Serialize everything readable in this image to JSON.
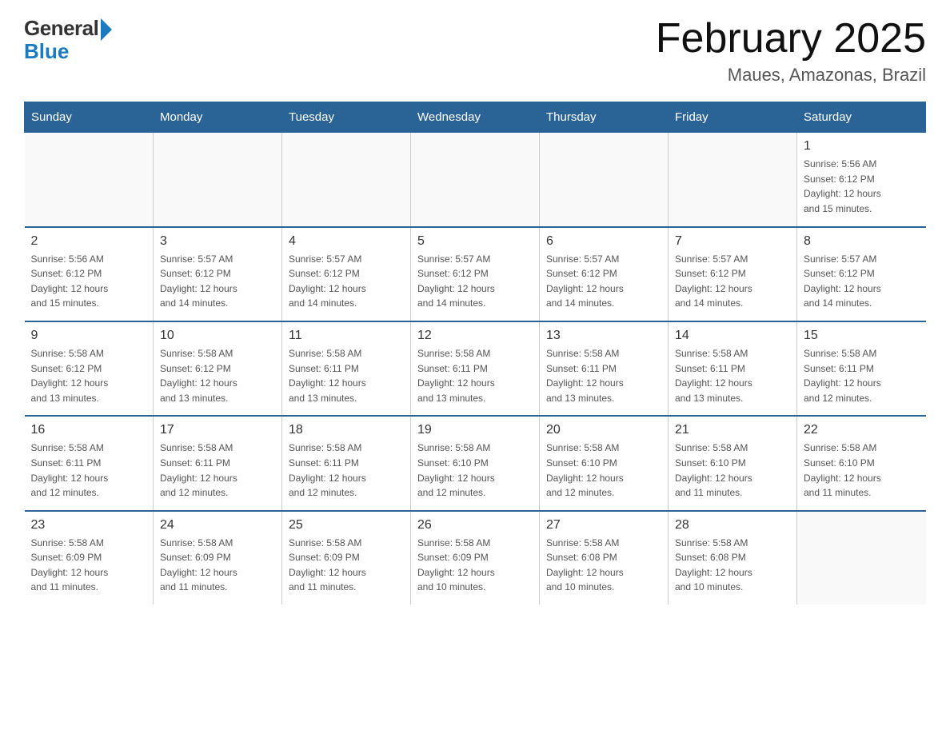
{
  "logo": {
    "general": "General",
    "blue": "Blue"
  },
  "title": "February 2025",
  "location": "Maues, Amazonas, Brazil",
  "days_of_week": [
    "Sunday",
    "Monday",
    "Tuesday",
    "Wednesday",
    "Thursday",
    "Friday",
    "Saturday"
  ],
  "weeks": [
    [
      {
        "day": "",
        "info": ""
      },
      {
        "day": "",
        "info": ""
      },
      {
        "day": "",
        "info": ""
      },
      {
        "day": "",
        "info": ""
      },
      {
        "day": "",
        "info": ""
      },
      {
        "day": "",
        "info": ""
      },
      {
        "day": "1",
        "info": "Sunrise: 5:56 AM\nSunset: 6:12 PM\nDaylight: 12 hours\nand 15 minutes."
      }
    ],
    [
      {
        "day": "2",
        "info": "Sunrise: 5:56 AM\nSunset: 6:12 PM\nDaylight: 12 hours\nand 15 minutes."
      },
      {
        "day": "3",
        "info": "Sunrise: 5:57 AM\nSunset: 6:12 PM\nDaylight: 12 hours\nand 14 minutes."
      },
      {
        "day": "4",
        "info": "Sunrise: 5:57 AM\nSunset: 6:12 PM\nDaylight: 12 hours\nand 14 minutes."
      },
      {
        "day": "5",
        "info": "Sunrise: 5:57 AM\nSunset: 6:12 PM\nDaylight: 12 hours\nand 14 minutes."
      },
      {
        "day": "6",
        "info": "Sunrise: 5:57 AM\nSunset: 6:12 PM\nDaylight: 12 hours\nand 14 minutes."
      },
      {
        "day": "7",
        "info": "Sunrise: 5:57 AM\nSunset: 6:12 PM\nDaylight: 12 hours\nand 14 minutes."
      },
      {
        "day": "8",
        "info": "Sunrise: 5:57 AM\nSunset: 6:12 PM\nDaylight: 12 hours\nand 14 minutes."
      }
    ],
    [
      {
        "day": "9",
        "info": "Sunrise: 5:58 AM\nSunset: 6:12 PM\nDaylight: 12 hours\nand 13 minutes."
      },
      {
        "day": "10",
        "info": "Sunrise: 5:58 AM\nSunset: 6:12 PM\nDaylight: 12 hours\nand 13 minutes."
      },
      {
        "day": "11",
        "info": "Sunrise: 5:58 AM\nSunset: 6:11 PM\nDaylight: 12 hours\nand 13 minutes."
      },
      {
        "day": "12",
        "info": "Sunrise: 5:58 AM\nSunset: 6:11 PM\nDaylight: 12 hours\nand 13 minutes."
      },
      {
        "day": "13",
        "info": "Sunrise: 5:58 AM\nSunset: 6:11 PM\nDaylight: 12 hours\nand 13 minutes."
      },
      {
        "day": "14",
        "info": "Sunrise: 5:58 AM\nSunset: 6:11 PM\nDaylight: 12 hours\nand 13 minutes."
      },
      {
        "day": "15",
        "info": "Sunrise: 5:58 AM\nSunset: 6:11 PM\nDaylight: 12 hours\nand 12 minutes."
      }
    ],
    [
      {
        "day": "16",
        "info": "Sunrise: 5:58 AM\nSunset: 6:11 PM\nDaylight: 12 hours\nand 12 minutes."
      },
      {
        "day": "17",
        "info": "Sunrise: 5:58 AM\nSunset: 6:11 PM\nDaylight: 12 hours\nand 12 minutes."
      },
      {
        "day": "18",
        "info": "Sunrise: 5:58 AM\nSunset: 6:11 PM\nDaylight: 12 hours\nand 12 minutes."
      },
      {
        "day": "19",
        "info": "Sunrise: 5:58 AM\nSunset: 6:10 PM\nDaylight: 12 hours\nand 12 minutes."
      },
      {
        "day": "20",
        "info": "Sunrise: 5:58 AM\nSunset: 6:10 PM\nDaylight: 12 hours\nand 12 minutes."
      },
      {
        "day": "21",
        "info": "Sunrise: 5:58 AM\nSunset: 6:10 PM\nDaylight: 12 hours\nand 11 minutes."
      },
      {
        "day": "22",
        "info": "Sunrise: 5:58 AM\nSunset: 6:10 PM\nDaylight: 12 hours\nand 11 minutes."
      }
    ],
    [
      {
        "day": "23",
        "info": "Sunrise: 5:58 AM\nSunset: 6:09 PM\nDaylight: 12 hours\nand 11 minutes."
      },
      {
        "day": "24",
        "info": "Sunrise: 5:58 AM\nSunset: 6:09 PM\nDaylight: 12 hours\nand 11 minutes."
      },
      {
        "day": "25",
        "info": "Sunrise: 5:58 AM\nSunset: 6:09 PM\nDaylight: 12 hours\nand 11 minutes."
      },
      {
        "day": "26",
        "info": "Sunrise: 5:58 AM\nSunset: 6:09 PM\nDaylight: 12 hours\nand 10 minutes."
      },
      {
        "day": "27",
        "info": "Sunrise: 5:58 AM\nSunset: 6:08 PM\nDaylight: 12 hours\nand 10 minutes."
      },
      {
        "day": "28",
        "info": "Sunrise: 5:58 AM\nSunset: 6:08 PM\nDaylight: 12 hours\nand 10 minutes."
      },
      {
        "day": "",
        "info": ""
      }
    ]
  ]
}
